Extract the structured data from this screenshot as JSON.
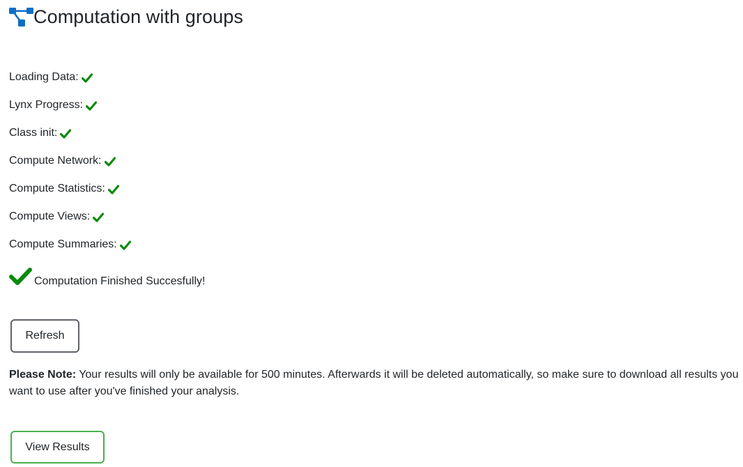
{
  "header": {
    "title": "Computation with groups",
    "icon": "diagram-tree-icon",
    "icon_color": "#0d6ec4"
  },
  "status_items": [
    {
      "label": "Loading Data:",
      "state": "done"
    },
    {
      "label": "Lynx Progress:",
      "state": "done"
    },
    {
      "label": "Class init:",
      "state": "done"
    },
    {
      "label": "Compute Network:",
      "state": "done"
    },
    {
      "label": "Compute Statistics:",
      "state": "done"
    },
    {
      "label": "Compute Views:",
      "state": "done"
    },
    {
      "label": "Compute Summaries:",
      "state": "done"
    }
  ],
  "finished": {
    "text": "Computation Finished Succesfully!"
  },
  "buttons": {
    "refresh_label": "Refresh",
    "view_results_label": "View Results"
  },
  "note": {
    "prefix": "Please Note:",
    "text": " Your results will only be available for 500 minutes. Afterwards it will be deleted automatically, so make sure to download all results you want to use after you've finished your analysis."
  },
  "colors": {
    "check": "#0a8a0a",
    "view_results_border": "#4caf50",
    "refresh_border": "#5f6368"
  }
}
